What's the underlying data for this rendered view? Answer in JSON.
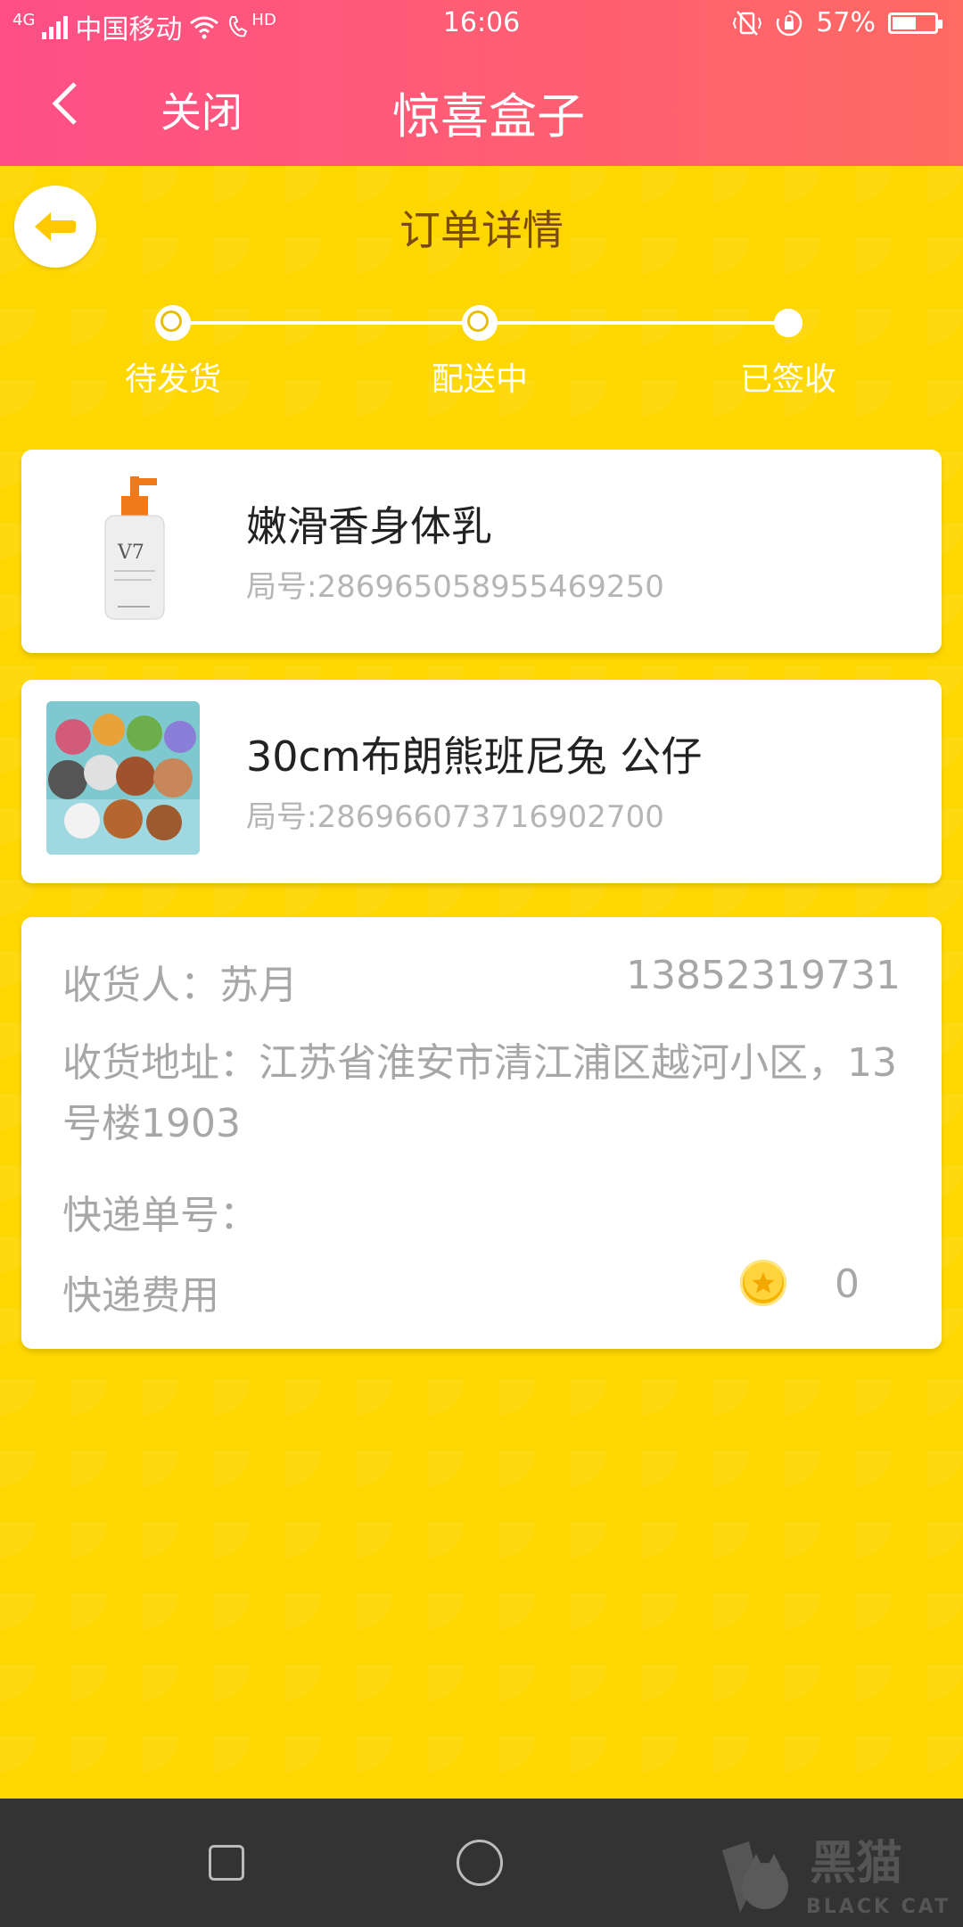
{
  "status": {
    "network": "4G",
    "carrier": "中国移动",
    "hd_badge": "HD",
    "time": "16:06",
    "battery": "57%",
    "battery_level": 0.57,
    "icons": [
      "signal-icon",
      "wifi-icon",
      "call-hd-icon",
      "vibrate-icon",
      "rotation-lock-icon",
      "battery-icon"
    ]
  },
  "header": {
    "close_label": "关闭",
    "title": "惊喜盒子"
  },
  "order": {
    "section_title": "订单详情",
    "steps": [
      {
        "label": "待发货"
      },
      {
        "label": "配送中"
      },
      {
        "label": "已签收"
      }
    ],
    "products": [
      {
        "name": "嫩滑香身体乳",
        "number": "局号:286965058955469250",
        "image": "lotion-bottle-image"
      },
      {
        "name": "30cm布朗熊班尼兔 公仔",
        "number": "局号:286966073716902700",
        "image": "plush-toys-image"
      }
    ]
  },
  "shipping": {
    "recipient": "收货人：苏月",
    "phone": "13852319731",
    "address": "收货地址：江苏省淮安市清江浦区越河小区，13号楼1903",
    "tracking_label": "快递单号：",
    "fee_label": "快递费用",
    "fee_value": "0",
    "coin_icon": "coin-icon"
  },
  "watermark": {
    "text_cn": "黑猫",
    "text_en": "BLACK CAT"
  },
  "colors": {
    "header_start": "#ff4f86",
    "header_end": "#ff6a63",
    "background": "#ffd700",
    "title_brown": "#7b4a12"
  }
}
